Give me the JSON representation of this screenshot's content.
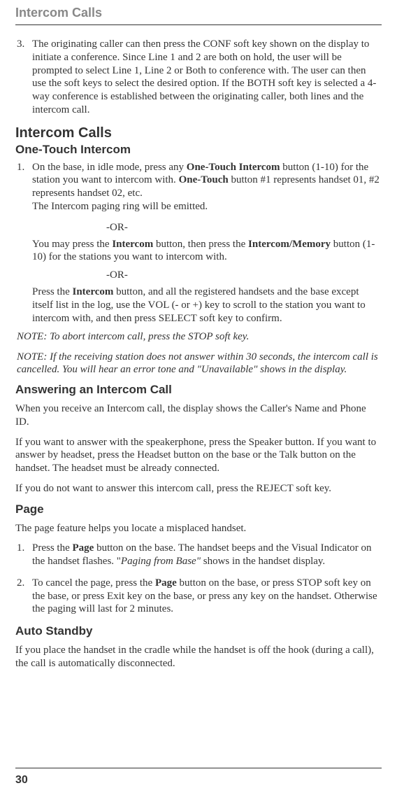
{
  "header": "Intercom Calls",
  "step3": {
    "num": "3.",
    "text": "The originating caller can then press the CONF soft key shown on the display to initiate a conference. Since Line 1 and 2 are both on hold, the user will be prompted to select Line 1, Line 2 or Both to conference with. The user can then use the soft keys to select the desired option. If the BOTH soft key is selected a 4-way conference is established between the originating caller, both lines and the intercom call."
  },
  "h1": "Intercom Calls",
  "h2a": "One-Touch Intercom",
  "step1": {
    "num": "1.",
    "p1a": "On the base, in idle mode, press any ",
    "p1b": "One-Touch Intercom",
    "p1c": " button (1-10) for the station you want to intercom with. ",
    "p1d": "One-Touch",
    "p1e": " button #1 represents handset 01, #2 represents handset 02, etc.",
    "p1f": "The Intercom paging ring will be emitted."
  },
  "or": "-OR-",
  "sub1": {
    "a": "You may press the ",
    "b": "Intercom",
    "c": " button, then press the ",
    "d": "Intercom/Memory",
    "e": " button (1-10) for the stations you want to intercom with."
  },
  "sub2": {
    "a": "Press the ",
    "b": "Intercom",
    "c": " button, and all the registered handsets and the base except itself list in the log, use the VOL (- or +) key to scroll to the station you want to intercom with, and then press SELECT soft key to confirm."
  },
  "note1": "NOTE: To abort intercom call, press the STOP soft key.",
  "note2": "NOTE: If the receiving station does not answer within 30 seconds, the intercom call is cancelled. You will hear an error tone and \"Unavailable\" shows in the display.",
  "h2b": "Answering an Intercom Call",
  "ans_p1": "When you receive an Intercom call, the display shows the Caller's Name and Phone ID.",
  "ans_p2": "If you want to answer with the speakerphone, press the Speaker button. If you want to answer by headset, press the Headset button on the base or the Talk button on the handset. The headset must be already connected.",
  "ans_p3": "If you do not want to answer this intercom call, press the REJECT soft key.",
  "h2c": "Page",
  "page_p1": "The page feature helps you locate a misplaced handset.",
  "page_s1": {
    "num": "1.",
    "a": "Press the ",
    "b": "Page",
    "c": " button on the base. The handset beeps and the Visual Indicator on the handset flashes. \"",
    "d": "Paging from Base\"",
    "e": " shows in the handset display."
  },
  "page_s2": {
    "num": "2.",
    "a": "To cancel the page, press the ",
    "b": "Page",
    "c": " button on the base, or press STOP soft key on the base, or press Exit key on the base, or press any key on the handset. Otherwise the paging will last for 2 minutes."
  },
  "h2d": "Auto Standby",
  "auto_p1": "If you place the handset in the cradle while the handset is off the hook (during a call), the call is automatically disconnected.",
  "page_num": "30"
}
